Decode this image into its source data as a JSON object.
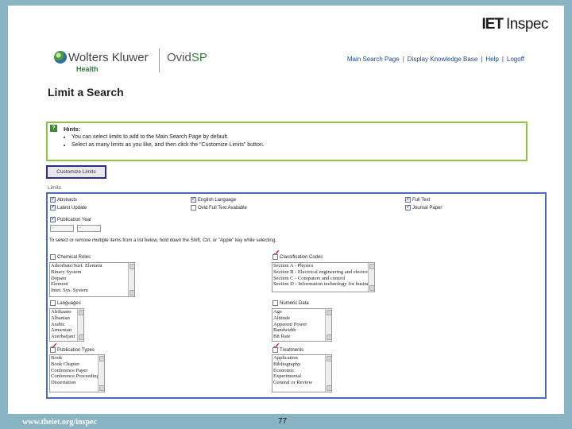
{
  "brand": {
    "iet": "IET",
    "inspec": "Inspec"
  },
  "header": {
    "logo_text": "Wolters Kluwer",
    "logo_sub": "Health",
    "product_prefix": "Ovid",
    "product_suffix": "SP",
    "links": [
      "Main Search Page",
      "Display Knowledge Base",
      "Help",
      "Logoff"
    ]
  },
  "page_title": "Limit a Search",
  "hints": {
    "icon": "?",
    "heading": "Hints:",
    "items": [
      "You can select limits to add to the Main Search Page by default.",
      "Select as many limits as you like, and then click the \"Customize Limits\" button."
    ]
  },
  "customize_button": "Customize Limits",
  "limits_label": "Limits",
  "checkboxes": {
    "abstracts": "Abstracts",
    "english_language": "English Language",
    "full_text": "Full Text",
    "latest_update": "Latest Update",
    "ovid_full_text": "Ovid Full Text Available",
    "journal_paper": "Journal Paper",
    "publication_year": "Publication Year"
  },
  "year_from": "-",
  "year_to": "-",
  "selection_note": "To select or remove multiple items from a list below, hold down the Shift, Ctrl, or \"Apple\" key while selecting.",
  "lists": {
    "chemical_roles": {
      "label": "Chemical Roles",
      "options": [
        "Adsorbate/Surf. Element",
        "Binary System",
        "Dopant",
        "Element",
        "Inter. Sys. System"
      ]
    },
    "classification_codes": {
      "label": "Classification Codes",
      "options": [
        "Section A - Physics",
        "Section B - Electrical engineering and electronics",
        "Section C - Computers and control",
        "Section D - Information technology for business"
      ]
    },
    "languages": {
      "label": "Languages",
      "options": [
        "Afrikaans",
        "Albanian",
        "Arabic",
        "Armenian",
        "Azerbaijani"
      ]
    },
    "numeric_data": {
      "label": "Numeric Data",
      "options": [
        "Age",
        "Altitude",
        "Apparent Power",
        "Bandwidth",
        "Bit Rate"
      ]
    },
    "publication_types": {
      "label": "Publication Types",
      "options": [
        "Book",
        "Book Chapter",
        "Conference Paper",
        "Conference Proceedings",
        "Dissertation"
      ]
    },
    "treatments": {
      "label": "Treatments",
      "options": [
        "Application",
        "Bibliography",
        "Economic",
        "Experimental",
        "General or Review"
      ]
    }
  },
  "footer": {
    "url": "www.theiet.org/inspec",
    "page_number": "77"
  },
  "colors": {
    "background": "#88b4c4",
    "hints_border": "#8cc63f",
    "limits_border": "#4a6fb8",
    "red_check": "#d42020"
  }
}
